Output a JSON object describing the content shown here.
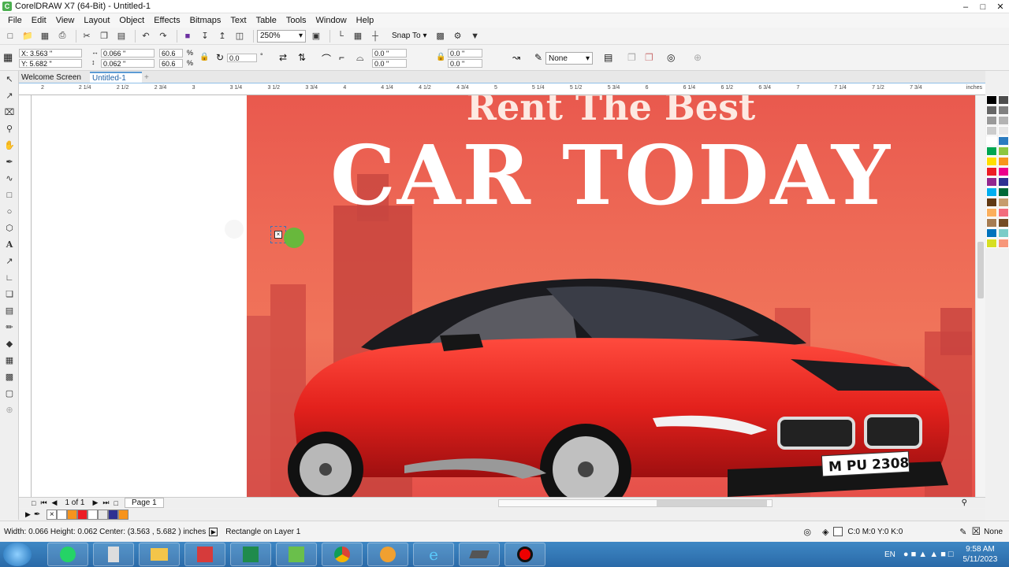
{
  "window": {
    "title": "CorelDRAW X7 (64-Bit) - Untitled-1"
  },
  "menu": [
    "File",
    "Edit",
    "View",
    "Layout",
    "Object",
    "Effects",
    "Bitmaps",
    "Text",
    "Table",
    "Tools",
    "Window",
    "Help"
  ],
  "toolbar": {
    "zoom": "250%",
    "snap_to": "Snap To"
  },
  "properties": {
    "x": "X: 3.563 \"",
    "y": "Y: 5.682 \"",
    "width": "0.066 \"",
    "height": "0.062 \"",
    "scale_w": "60.6",
    "scale_h": "60.6",
    "percent": "%",
    "rotation": "0.0",
    "degree": "°",
    "corner1": "0.0 \"",
    "corner2": "0.0 \"",
    "corner3": "0.0 \"",
    "corner4": "0.0 \"",
    "outline": "None"
  },
  "tabs": [
    {
      "label": "Welcome Screen",
      "active": false
    },
    {
      "label": "Untitled-1",
      "active": true
    }
  ],
  "ruler": {
    "h_ticks": [
      "2",
      "2 1/4",
      "2 1/2",
      "2 3/4",
      "3",
      "3 1/4",
      "3 1/2",
      "3 3/4",
      "4",
      "4 1/4",
      "4 1/2",
      "4 3/4",
      "5",
      "5 1/4",
      "5 1/2",
      "5 3/4",
      "6",
      "6 1/4",
      "6 1/2",
      "6 3/4",
      "7",
      "7 1/4",
      "7 1/2",
      "7 3/4"
    ],
    "unit": "inches"
  },
  "poster": {
    "headline_top": "Rent The Best",
    "headline_main": "CAR TODAY",
    "plate": "M PU 2308"
  },
  "pager": {
    "counter": "1 of 1",
    "page_tab": "Page 1"
  },
  "status": {
    "dims": "Width: 0.066  Height: 0.062  Center: (3.563 , 5.682 )  inches",
    "object": "Rectangle on Layer 1",
    "color": "C:0 M:0 Y:0 K:0",
    "outline": "None"
  },
  "taskbar": {
    "lang": "EN",
    "time": "9:58 AM",
    "date": "5/11/2023"
  },
  "colors": {
    "accent": "#5b9bd5",
    "poster_red": "#e9594e",
    "palette": [
      "#000000",
      "#4d4d4d",
      "#666666",
      "#808080",
      "#999999",
      "#b3b3b3",
      "#cccccc",
      "#e6e6e6",
      "#ffffff",
      "#2b7bbf",
      "#00a651",
      "#8dc63f",
      "#ffde00",
      "#f7941d",
      "#ed1c24",
      "#ec008c",
      "#92278f",
      "#2e3192",
      "#00aeef",
      "#006838",
      "#603913",
      "#c69c6d",
      "#fbaf5d",
      "#f26d7d",
      "#a67c52",
      "#754c24",
      "#0072bc",
      "#7accc8",
      "#d7df23",
      "#f7977a"
    ],
    "doc_palette": [
      "#ffffff",
      "#f7941d",
      "#ed1c24",
      "#ffffff",
      "#e6e6e6",
      "#2e3192",
      "#f7941d"
    ]
  }
}
